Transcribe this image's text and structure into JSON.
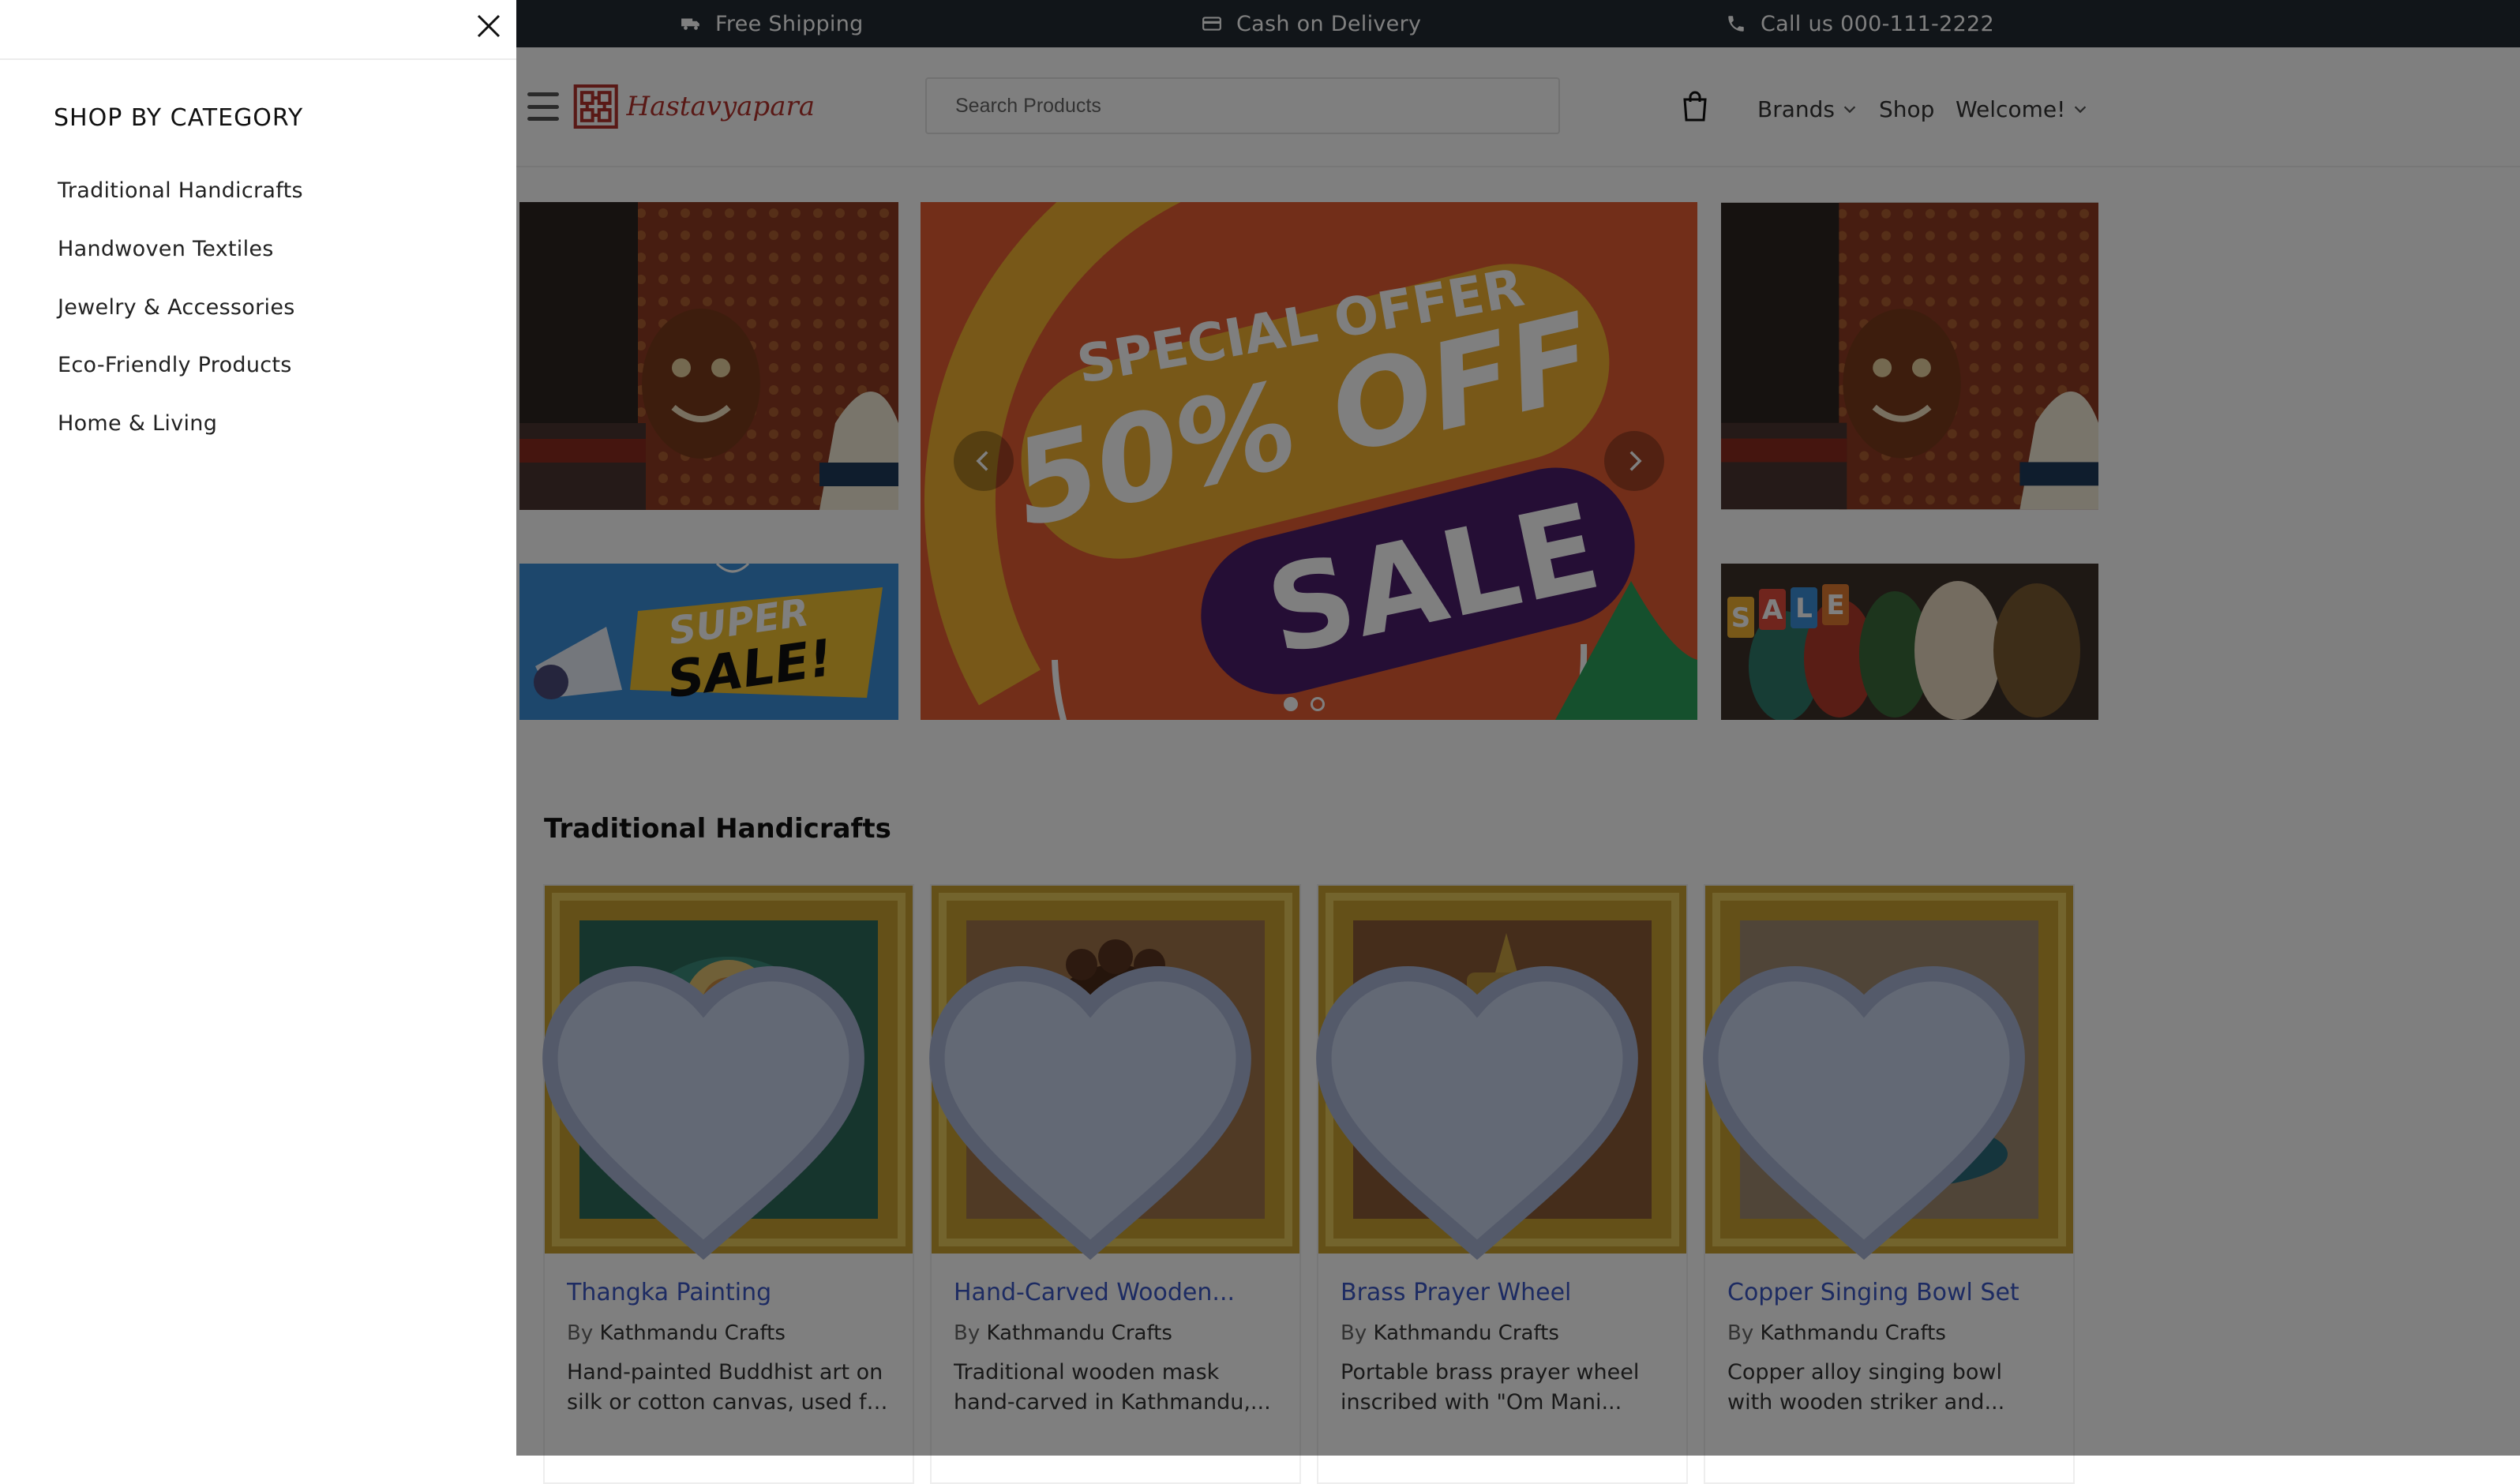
{
  "topbar": {
    "items": [
      {
        "icon": "truck-icon",
        "label": "Free Shipping"
      },
      {
        "icon": "credit-card-icon",
        "label": "Cash on Delivery"
      },
      {
        "icon": "phone-icon",
        "label": "Call us 000-111-2222"
      }
    ]
  },
  "header": {
    "logo_text": "Hastavyapara",
    "search_placeholder": "Search Products",
    "nav": {
      "brands": "Brands",
      "shop": "Shop",
      "welcome": "Welcome!"
    }
  },
  "banners": {
    "main": {
      "line1": "SPECIAL OFFER",
      "line2": "50% OFF",
      "line3": "SALE",
      "active_slide": 1,
      "slide_count": 2
    },
    "bottom_left": {
      "line1": "SUPER",
      "line2": "SALE!"
    },
    "bottom_right": {
      "letters": [
        "S",
        "A",
        "L",
        "E"
      ]
    }
  },
  "section": {
    "title": "Traditional Handicrafts",
    "by_prefix": "By",
    "products": [
      {
        "title": "Thangka Painting",
        "brand": "Kathmandu Crafts",
        "desc_line1": "Hand-painted Buddhist art on",
        "desc_line2": "silk or cotton canvas, used fo..."
      },
      {
        "title": "Hand-Carved Wooden...",
        "brand": "Kathmandu Crafts",
        "desc_line1": "Traditional wooden mask",
        "desc_line2": "hand-carved in Kathmandu,..."
      },
      {
        "title": "Brass Prayer Wheel",
        "brand": "Kathmandu Crafts",
        "desc_line1": "Portable brass prayer wheel",
        "desc_line2": "inscribed with \"Om Mani..."
      },
      {
        "title": "Copper Singing Bowl Set",
        "brand": "Kathmandu Crafts",
        "desc_line1": "Copper alloy singing bowl",
        "desc_line2": "with wooden striker and..."
      }
    ]
  },
  "drawer": {
    "heading": "SHOP BY CATEGORY",
    "items": [
      "Traditional Handicrafts",
      "Handwoven Textiles",
      "Jewelry & Accessories",
      "Eco-Friendly Products",
      "Home & Living"
    ]
  },
  "colors": {
    "topbar_bg": "#222b33",
    "link_blue": "#3a56c5",
    "logo_red": "#b3322c",
    "overlay": "rgba(0,0,0,0.5)"
  }
}
